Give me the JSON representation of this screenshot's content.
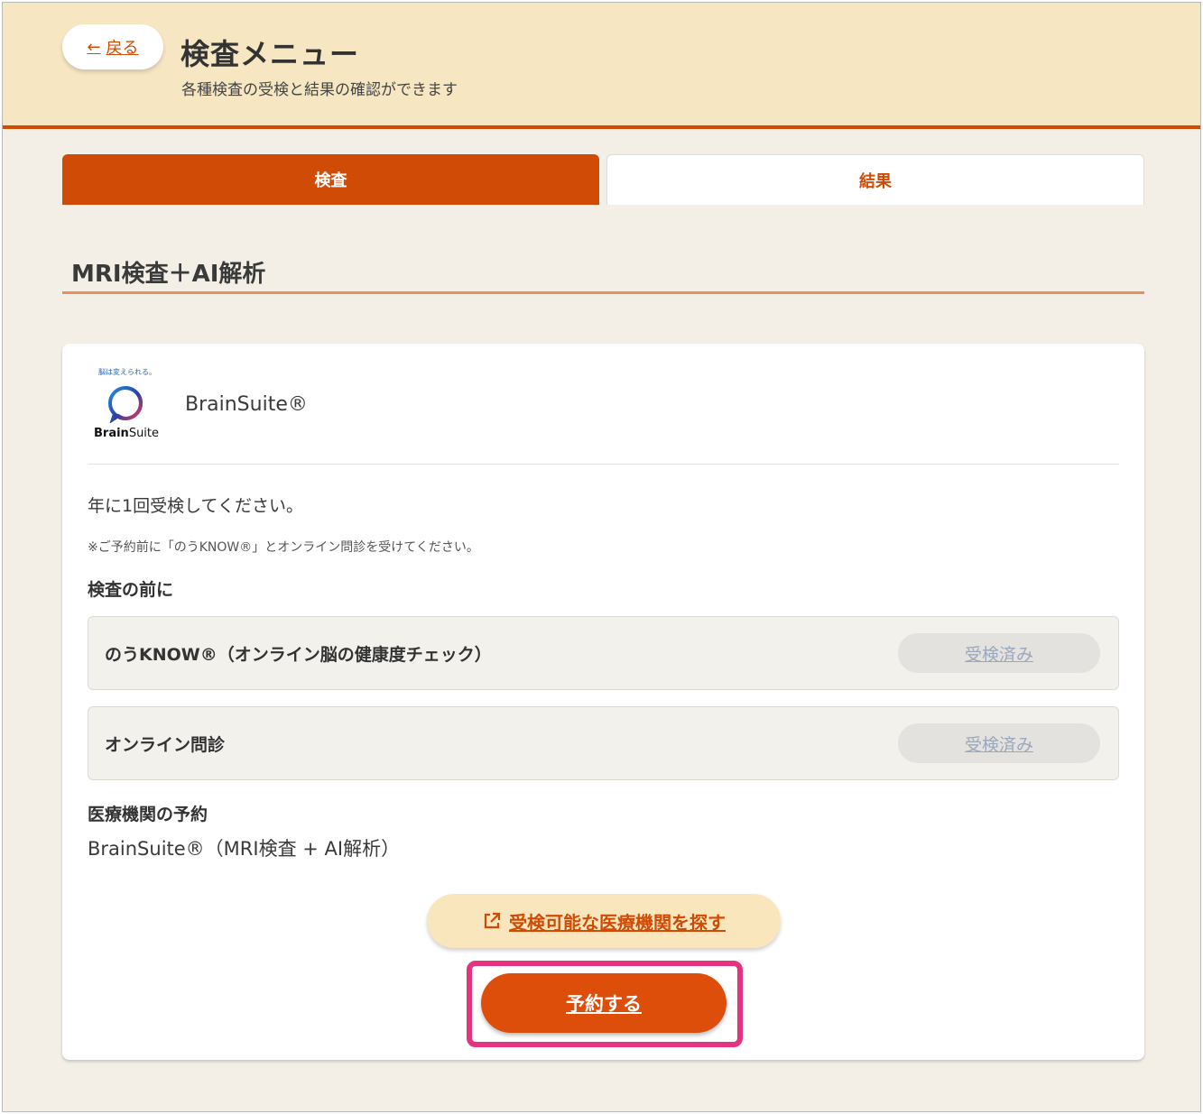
{
  "header": {
    "back_label": "戻る",
    "title": "検査メニュー",
    "subtitle": "各種検査の受検と結果の確認ができます"
  },
  "tabs": [
    {
      "label": "検査",
      "active": true
    },
    {
      "label": "結果",
      "active": false
    }
  ],
  "section": {
    "title": "MRI検査＋AI解析"
  },
  "card": {
    "logo": {
      "tagline": "脳は変えられる。",
      "word_bold": "Brain",
      "word_regular": "Suite",
      "icon": "brainsuite-ring-logo"
    },
    "product_name": "BrainSuite®",
    "frequency": "年に1回受検してください。",
    "note": "※ご予約前に「のうKNOW®」とオンライン問診を受けてください。",
    "pre_heading": "検査の前に",
    "tasks": [
      {
        "label": "のうKNOW®（オンライン脳の健康度チェック）",
        "status": "受検済み"
      },
      {
        "label": "オンライン問診",
        "status": "受検済み"
      }
    ],
    "reserve_heading": "医療機関の予約",
    "reserve_facility": "BrainSuite®（MRI検査 + AI解析）",
    "find_button": {
      "label": "受検可能な医療機関を探す",
      "icon": "external-link-icon"
    },
    "reserve_button": {
      "label": "予約する"
    }
  },
  "colors": {
    "accent": "#d04b05",
    "header_bg": "#f6e6c2",
    "page_bg": "#f3efe7",
    "highlight": "#e6337f"
  }
}
